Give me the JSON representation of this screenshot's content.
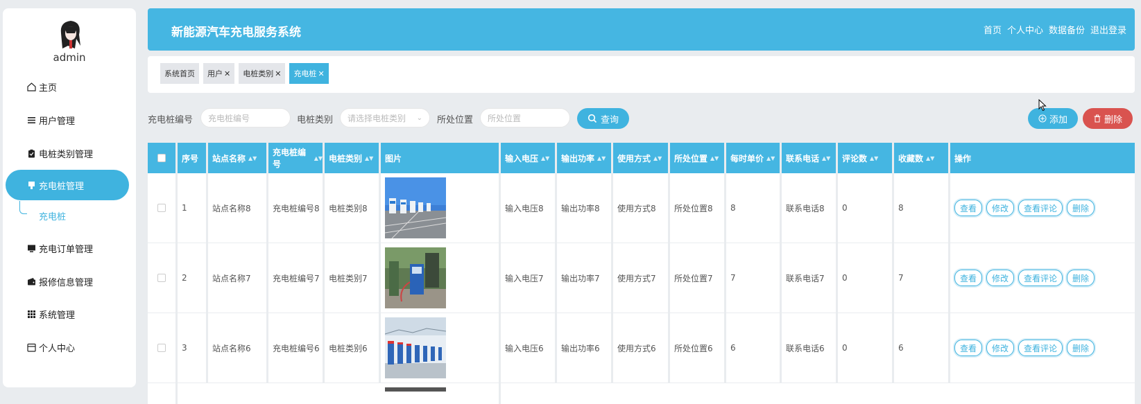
{
  "sidebar": {
    "username": "admin",
    "items": [
      {
        "label": "主页",
        "icon": "home-icon"
      },
      {
        "label": "用户管理",
        "icon": "list-icon"
      },
      {
        "label": "电桩类别管理",
        "icon": "clipboard-icon"
      },
      {
        "label": "充电桩管理",
        "icon": "charger-icon",
        "active": true
      },
      {
        "label": "充电订单管理",
        "icon": "monitor-icon"
      },
      {
        "label": "报修信息管理",
        "icon": "wallet-icon"
      },
      {
        "label": "系统管理",
        "icon": "grid-icon"
      },
      {
        "label": "个人中心",
        "icon": "calendar-icon"
      }
    ],
    "sub_item": "充电桩"
  },
  "header": {
    "title": "新能源汽车充电服务系统",
    "nav": [
      "首页",
      "个人中心",
      "数据备份",
      "退出登录"
    ]
  },
  "tabs": [
    {
      "label": "系统首页",
      "closable": false
    },
    {
      "label": "用户",
      "closable": true
    },
    {
      "label": "电桩类别",
      "closable": true
    },
    {
      "label": "充电桩",
      "closable": true,
      "active": true
    }
  ],
  "filters": {
    "f1_label": "充电桩编号",
    "f1_placeholder": "充电桩编号",
    "f2_label": "电桩类别",
    "f2_placeholder": "请选择电桩类别",
    "f3_label": "所处位置",
    "f3_placeholder": "所处位置",
    "query": "查询"
  },
  "actions": {
    "add": "添加",
    "delete": "删除"
  },
  "table": {
    "columns": [
      "序号",
      "站点名称",
      "充电桩编号",
      "电桩类别",
      "图片",
      "输入电压",
      "输出功率",
      "使用方式",
      "所处位置",
      "每时单价",
      "联系电话",
      "评论数",
      "收藏数",
      "操作"
    ],
    "rows": [
      {
        "no": "1",
        "site": "站点名称8",
        "code": "充电桩编号8",
        "type": "电桩类别8",
        "vin": "输入电压8",
        "pout": "输出功率8",
        "usage": "使用方式8",
        "loc": "所处位置8",
        "price": "8",
        "phone": "联系电话8",
        "comments": "0",
        "favs": "8"
      },
      {
        "no": "2",
        "site": "站点名称7",
        "code": "充电桩编号7",
        "type": "电桩类别7",
        "vin": "输入电压7",
        "pout": "输出功率7",
        "usage": "使用方式7",
        "loc": "所处位置7",
        "price": "7",
        "phone": "联系电话7",
        "comments": "0",
        "favs": "7"
      },
      {
        "no": "3",
        "site": "站点名称6",
        "code": "充电桩编号6",
        "type": "电桩类别6",
        "vin": "输入电压6",
        "pout": "输出功率6",
        "usage": "使用方式6",
        "loc": "所处位置6",
        "price": "6",
        "phone": "联系电话6",
        "comments": "0",
        "favs": "6"
      }
    ],
    "op_labels": {
      "view": "查看",
      "edit": "修改",
      "reviews": "查看评论",
      "delete": "删除"
    }
  },
  "colors": {
    "accent": "#45b6e2",
    "danger": "#d9534f"
  }
}
